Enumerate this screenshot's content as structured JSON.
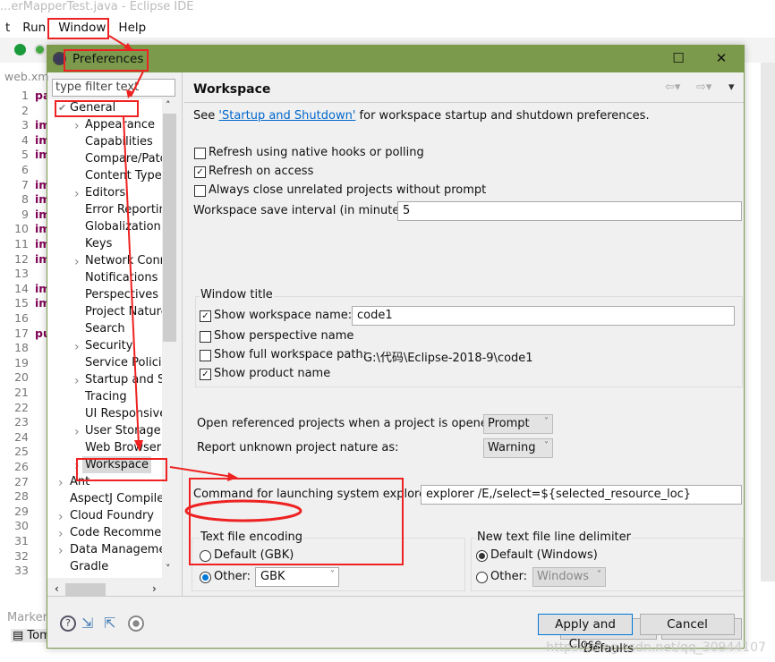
{
  "ide": {
    "title": "...erMapperTest.java - Eclipse IDE",
    "menu": [
      "t",
      "Run",
      "Window",
      "Help"
    ],
    "editor_tab": "web.xm",
    "line_numbers": [
      "1",
      "2",
      "3",
      "4",
      "5",
      "6",
      "7",
      "8",
      "9",
      "10",
      "11",
      "12",
      "13",
      "14",
      "15",
      "16",
      "17",
      "18",
      "19",
      "20",
      "21",
      "22",
      "23",
      "24",
      "25",
      "26",
      "27",
      "28",
      "29",
      "30",
      "31",
      "32",
      "33"
    ],
    "code": {
      "1": "pac",
      "3": "imp",
      "4": "imp",
      "5": "imp",
      "7": "imp",
      "8": "imp",
      "9": "imp",
      "10": "imp",
      "11": "imp",
      "12": "imp",
      "14": "imp",
      "15": "imp",
      "17": "pub"
    },
    "bottom_tabs": [
      "Marker",
      "Tom"
    ]
  },
  "dialog": {
    "title": "Preferences",
    "filter_placeholder": "type filter text",
    "tree": [
      {
        "label": "General",
        "level": 0,
        "expanded": true
      },
      {
        "label": "Appearance",
        "level": 1,
        "arrow": true
      },
      {
        "label": "Capabilities",
        "level": 1
      },
      {
        "label": "Compare/Patch",
        "level": 1
      },
      {
        "label": "Content Types",
        "level": 1
      },
      {
        "label": "Editors",
        "level": 1,
        "arrow": true
      },
      {
        "label": "Error Reporting",
        "level": 1
      },
      {
        "label": "Globalization",
        "level": 1
      },
      {
        "label": "Keys",
        "level": 1
      },
      {
        "label": "Network Connections",
        "level": 1,
        "arrow": true
      },
      {
        "label": "Notifications",
        "level": 1
      },
      {
        "label": "Perspectives",
        "level": 1
      },
      {
        "label": "Project Natures",
        "level": 1
      },
      {
        "label": "Search",
        "level": 1
      },
      {
        "label": "Security",
        "level": 1,
        "arrow": true
      },
      {
        "label": "Service Policies",
        "level": 1
      },
      {
        "label": "Startup and Shutdown",
        "level": 1,
        "arrow": true
      },
      {
        "label": "Tracing",
        "level": 1
      },
      {
        "label": "UI Responsiveness",
        "level": 1
      },
      {
        "label": "User Storage",
        "level": 1,
        "arrow": true
      },
      {
        "label": "Web Browser",
        "level": 1
      },
      {
        "label": "Workspace",
        "level": 1,
        "arrow": true,
        "selected": true
      },
      {
        "label": "Ant",
        "level": 0,
        "arrow": true
      },
      {
        "label": "AspectJ Compiler",
        "level": 0
      },
      {
        "label": "Cloud Foundry",
        "level": 0,
        "arrow": true
      },
      {
        "label": "Code Recommenders",
        "level": 0,
        "arrow": true
      },
      {
        "label": "Data Management",
        "level": 0,
        "arrow": true
      },
      {
        "label": "Gradle",
        "level": 0
      }
    ],
    "page": {
      "title": "Workspace",
      "see_prefix": "See ",
      "see_link": "'Startup and Shutdown'",
      "see_suffix": " for workspace startup and shutdown preferences.",
      "refresh_native": {
        "label": "Refresh using native hooks or polling",
        "checked": false
      },
      "refresh_access": {
        "label": "Refresh on access",
        "checked": true
      },
      "always_close": {
        "label": "Always close unrelated projects without prompt",
        "checked": false
      },
      "save_interval_label": "Workspace save interval (in minutes):",
      "save_interval": "5",
      "window_title": {
        "legend": "Window title",
        "show_ws_name": {
          "label": "Show workspace name:",
          "checked": true,
          "value": "code1"
        },
        "show_perspective": {
          "label": "Show perspective name",
          "checked": false
        },
        "show_full_path": {
          "label": "Show full workspace path:",
          "checked": false,
          "value": "G:\\代码\\Eclipse-2018-9\\code1"
        },
        "show_product": {
          "label": "Show product name",
          "checked": true
        }
      },
      "open_ref_label": "Open referenced projects when a project is opened:",
      "open_ref_value": "Prompt",
      "report_label": "Report unknown project nature as:",
      "report_value": "Warning",
      "explorer_label": "Command for launching system explorer:",
      "explorer_value": "explorer /E,/select=${selected_resource_loc}",
      "encoding": {
        "legend": "Text file encoding",
        "default_label": "Default (GBK)",
        "other_label": "Other:",
        "other_value": "GBK",
        "selected": "other"
      },
      "delimiter": {
        "legend": "New text file line delimiter",
        "default_label": "Default (Windows)",
        "other_label": "Other:",
        "other_value": "Windows",
        "selected": "default"
      },
      "restore_defaults": "Restore Defaults",
      "apply": "Apply"
    },
    "apply_close": "Apply and Close",
    "cancel": "Cancel"
  },
  "watermark": "https://blog.csdn.net/qq_30944107",
  "colors": {
    "titlebar": "#7b9a4b",
    "annotation": "#ee2222",
    "link": "#0066cc"
  }
}
